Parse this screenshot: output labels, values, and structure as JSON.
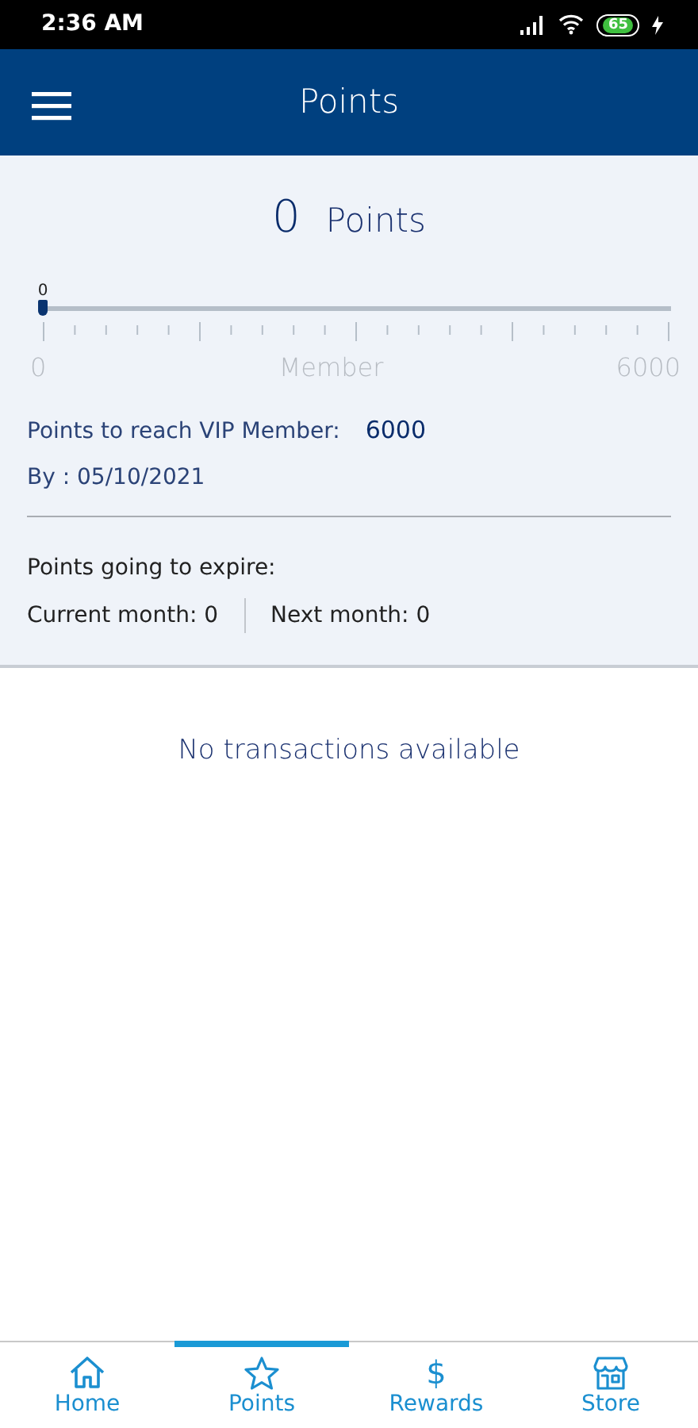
{
  "status_bar": {
    "time": "2:36 AM",
    "battery": "65",
    "charging": true
  },
  "header": {
    "title": "Points"
  },
  "summary": {
    "points": "0",
    "points_label": "Points",
    "progress": {
      "level": 0,
      "thumb_label": "0",
      "start_label": "0",
      "middle_label": "Member",
      "end_label": "6000"
    },
    "vip_label": "Points to reach VIP Member:",
    "vip_value": "6000",
    "by_date": "By : 05/10/2021",
    "expire_title": "Points going to expire:",
    "current_month": "Current month: 0",
    "next_month": "Next month: 0"
  },
  "empty_message": "No transactions available",
  "tabs": [
    {
      "kind": "home",
      "label": "Home",
      "selected": false
    },
    {
      "kind": "star",
      "label": "Points",
      "selected": true
    },
    {
      "kind": "dollar",
      "label": "Rewards",
      "glyph": "$",
      "selected": false
    },
    {
      "kind": "store",
      "label": "Store",
      "selected": false
    }
  ]
}
